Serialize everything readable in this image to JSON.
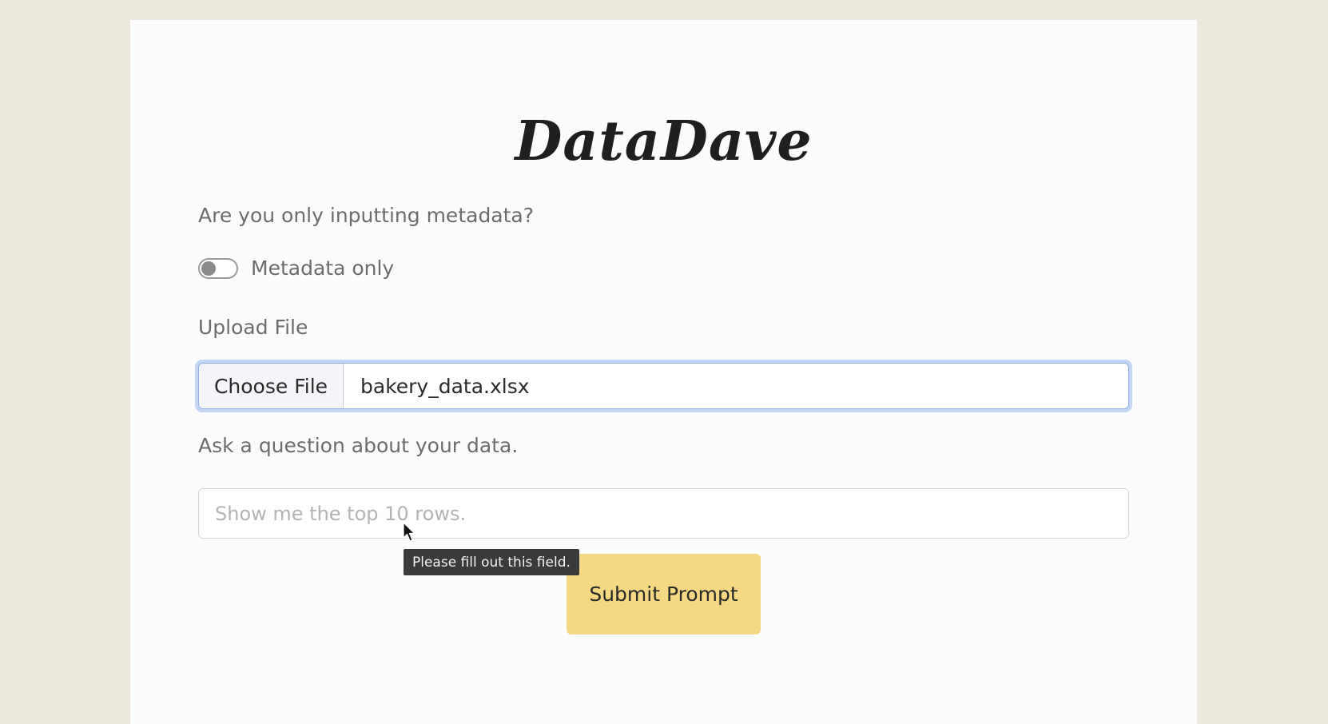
{
  "app": {
    "logo": "DataDave"
  },
  "form": {
    "metadata_question": "Are you only inputting metadata?",
    "metadata_toggle_label": "Metadata only",
    "metadata_toggle_on": false,
    "upload_label": "Upload File",
    "choose_file_label": "Choose File",
    "chosen_file_name": "bakery_data.xlsx",
    "question_label": "Ask a question about your data.",
    "question_value": "",
    "question_placeholder": "Show me the top 10 rows.",
    "validation_tooltip": "Please fill out this field.",
    "submit_label": "Submit Prompt"
  },
  "colors": {
    "page_background": "#ece8de",
    "card_background": "#fcfcfc",
    "submit_button": "#f5d784",
    "focus_ring": "#c3d7f5",
    "tooltip_background": "#3a3a3a"
  },
  "icons": {
    "cursor": "mouse-pointer-icon"
  }
}
